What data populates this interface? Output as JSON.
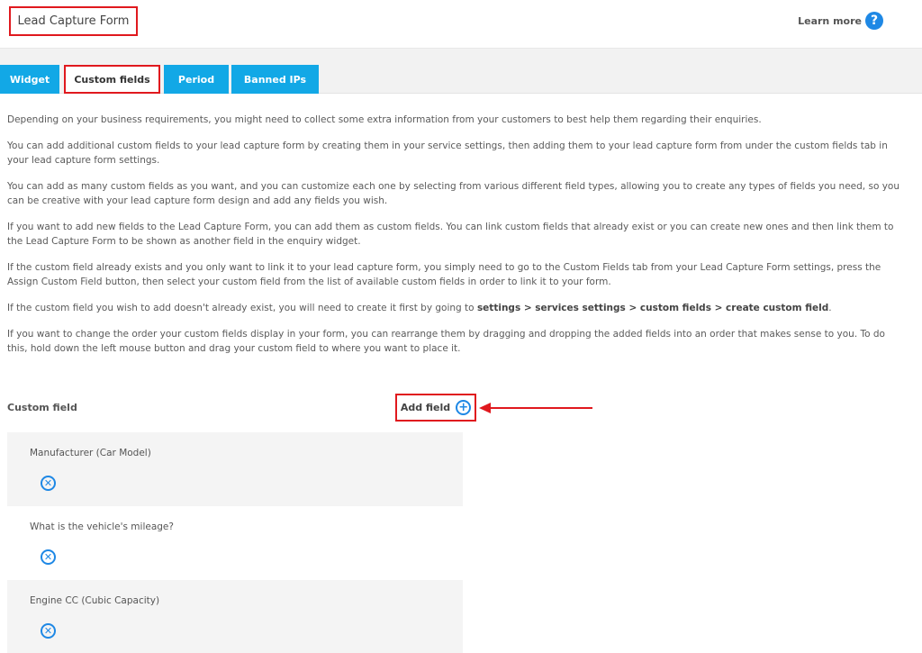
{
  "header": {
    "title": "Lead Capture Form",
    "learn_more": "Learn more",
    "help_icon": "question-circle-icon"
  },
  "tabs": [
    {
      "label": "Widget",
      "active": false
    },
    {
      "label": "Custom fields",
      "active": true
    },
    {
      "label": "Period",
      "active": false
    },
    {
      "label": "Banned IPs",
      "active": false
    }
  ],
  "content": {
    "p1": "Depending on your business requirements, you might need to collect some extra information from your customers to best help them regarding their enquiries.",
    "p2": "You can add additional custom fields to your lead capture form by creating them in your service settings, then adding them to your lead capture form from under the custom fields tab in your lead capture form settings.",
    "p3": "You can add as many custom fields as you want, and you can customize each one by selecting from various different field types, allowing you to create any types of fields you need, so you can be creative with your lead capture form design and add any fields you wish.",
    "p4": "If you want to add new fields to the Lead Capture Form, you can add them as custom fields. You can link custom fields that already exist or you can create new ones and then link them to the Lead Capture Form to be shown as another field in the enquiry widget.",
    "p5": "If the custom field already exists and you only want to link it to your lead capture form, you simply need to go to the Custom Fields tab from your Lead Capture Form settings, press the Assign Custom Field button, then select your custom field from the list of available custom fields in order to link it to your form.",
    "p6_pre": "If the custom field you wish to add doesn't already exist, you will need to create it first by going to ",
    "p6_bold": "settings > services settings > custom fields > create custom field",
    "p6_post": ".",
    "p7": "If you want to change the order your custom fields display in your form, you can rearrange them by dragging and dropping the added fields into an order that makes sense to you. To do this, hold down the left mouse button and drag your custom field to where you want to place it."
  },
  "custom_field": {
    "label": "Custom field",
    "add_label": "Add field",
    "add_icon": "plus-circle-icon",
    "fields": [
      {
        "name": "Manufacturer (Car Model)"
      },
      {
        "name": "What is the vehicle's mileage?"
      },
      {
        "name": "Engine CC (Cubic Capacity)"
      }
    ]
  },
  "colors": {
    "accent": "#12a8e6",
    "highlight": "#e0191e",
    "icon": "#1e88e5"
  }
}
